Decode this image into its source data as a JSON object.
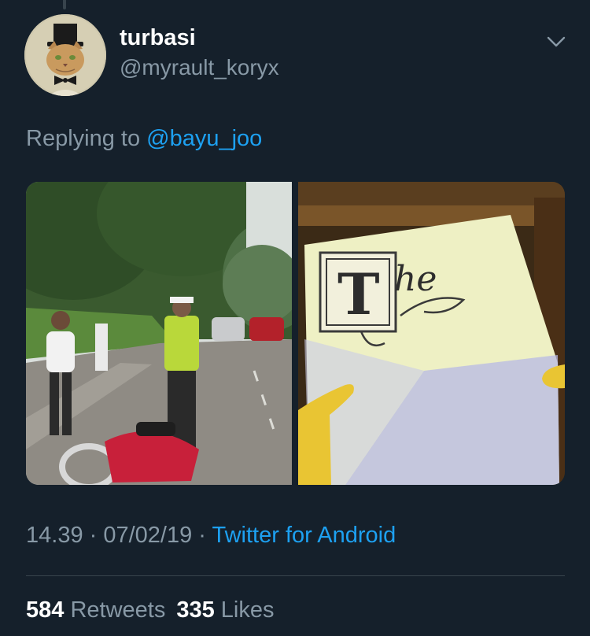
{
  "tweet": {
    "display_name": "turbasi",
    "handle": "@myrault_koryx",
    "replying_prefix": "Replying to ",
    "replying_to": "@bayu_joo",
    "time": "14.39",
    "separator": " · ",
    "date": "07/02/19",
    "source": "Twitter for Android",
    "retweet_count": "584",
    "retweet_label": "Retweets",
    "like_count": "335",
    "like_label": "Likes",
    "media": [
      {
        "description_icon": "street-scene-photo"
      },
      {
        "description_icon": "cartoon-scroll-photo",
        "scroll_text": "The"
      }
    ]
  },
  "colors": {
    "background": "#15202b",
    "secondary_text": "#8899a6",
    "accent": "#1da1f2",
    "divider": "#38444d"
  }
}
